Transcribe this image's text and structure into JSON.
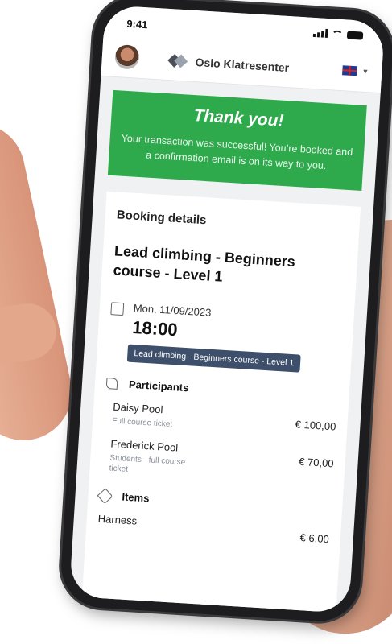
{
  "status_bar": {
    "time": "9:41"
  },
  "header": {
    "brand_name": "Oslo Klatresenter",
    "language": "UK flag"
  },
  "colors": {
    "success_banner": "#2ea94b",
    "event_tag": "#3d4f6b"
  },
  "success": {
    "title": "Thank you!",
    "message": "Your transaction was successful! You’re booked and a confirmation email is on its way to you."
  },
  "booking": {
    "section_title": "Booking details",
    "course_title": "Lead climbing - Beginners course - Level 1",
    "date": "Mon, 11/09/2023",
    "time": "18:00",
    "event_tag": "Lead climbing - Beginners course - Level 1"
  },
  "participants": {
    "title": "Participants",
    "list": [
      {
        "name": "Daisy Pool",
        "ticket": "Full course ticket",
        "price": "€ 100,00"
      },
      {
        "name": "Frederick Pool",
        "ticket": "Students - full course ticket",
        "price": "€ 70,00"
      }
    ]
  },
  "items": {
    "title": "Items",
    "list": [
      {
        "name": "Harness",
        "price": "€ 6,00"
      }
    ]
  }
}
